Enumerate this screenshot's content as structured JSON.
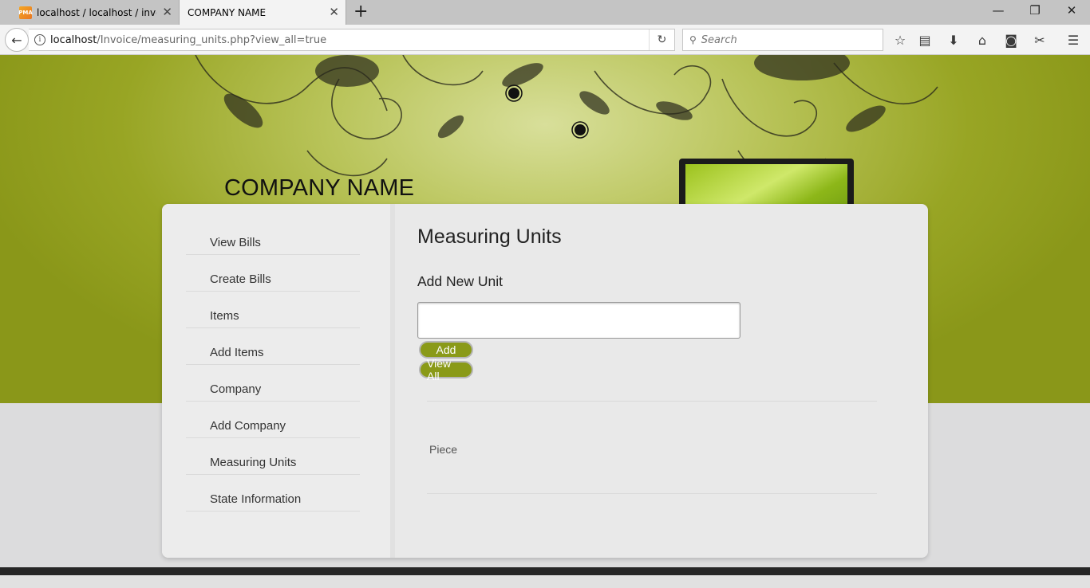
{
  "browser": {
    "tabs": [
      {
        "title": "localhost / localhost / invoic",
        "active": false,
        "favicon": "phpmyadmin-icon"
      },
      {
        "title": "COMPANY NAME",
        "active": true
      }
    ],
    "url": {
      "host": "localhost",
      "path": "/Invoice/measuring_units.php?view_all=true"
    },
    "search_placeholder": "Search",
    "window_controls": [
      "minimize",
      "restore",
      "close"
    ]
  },
  "header": {
    "company_name": "COMPANY NAME"
  },
  "sidebar": {
    "items": [
      {
        "label": "View Bills"
      },
      {
        "label": "Create Bills"
      },
      {
        "label": "Items"
      },
      {
        "label": "Add Items"
      },
      {
        "label": "Company"
      },
      {
        "label": "Add Company"
      },
      {
        "label": "Measuring Units"
      },
      {
        "label": "State Information"
      }
    ]
  },
  "main": {
    "title": "Measuring Units",
    "form_heading": "Add New Unit",
    "unit_input_value": "",
    "add_label": "Add",
    "view_all_label": "View All",
    "units": [
      "Piece"
    ]
  },
  "colors": {
    "hero_green": "#8e9a1c",
    "button_green": "#8a9a18",
    "panel_bg": "#e9e9e9",
    "page_grey": "#dcdcdd",
    "footer_dark": "#262626"
  }
}
